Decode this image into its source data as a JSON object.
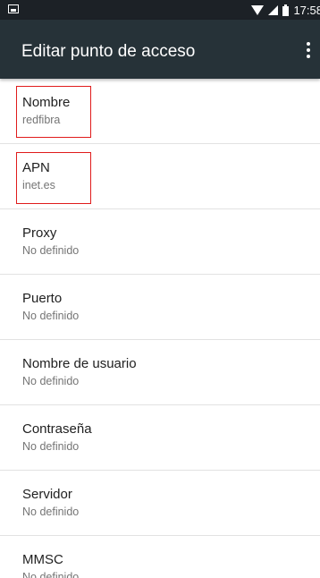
{
  "status_bar": {
    "time": "17:58",
    "icons": [
      "image-notification-icon",
      "wifi-icon",
      "signal-icon",
      "battery-icon"
    ]
  },
  "app_bar": {
    "title": "Editar punto de acceso",
    "overflow_icon": "more-vert-icon"
  },
  "colors": {
    "status_bar": "#1c2126",
    "app_bar": "#263238",
    "highlight": "#e01b1b",
    "divider": "#e2e2e2"
  },
  "settings": [
    {
      "label": "Nombre",
      "value": "redfibra"
    },
    {
      "label": "APN",
      "value": "inet.es"
    },
    {
      "label": "Proxy",
      "value": "No definido"
    },
    {
      "label": "Puerto",
      "value": "No definido"
    },
    {
      "label": "Nombre de usuario",
      "value": "No definido"
    },
    {
      "label": "Contraseña",
      "value": "No definido"
    },
    {
      "label": "Servidor",
      "value": "No definido"
    },
    {
      "label": "MMSC",
      "value": "No definido"
    }
  ]
}
